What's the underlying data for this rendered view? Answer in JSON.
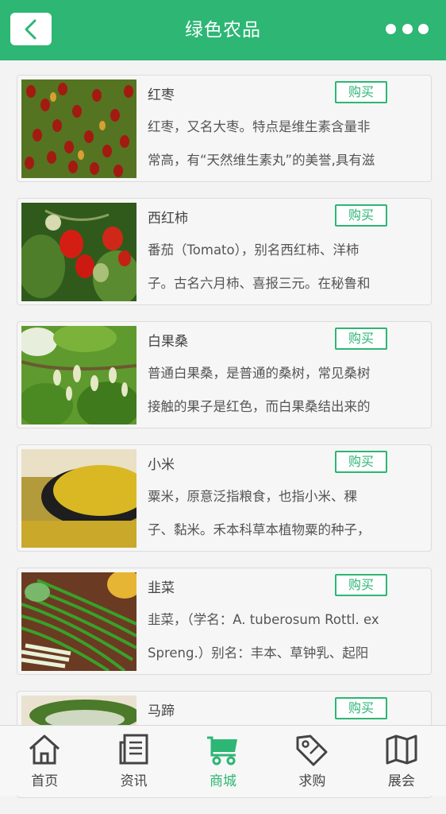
{
  "header": {
    "title": "绿色农品"
  },
  "products": [
    {
      "name": "红枣",
      "buy": "购买",
      "lines": [
        "红枣，又名大枣。特点是维生素含量非",
        "常高，有“天然维生素丸”的美誉,具有滋"
      ]
    },
    {
      "name": "西红柿",
      "buy": "购买",
      "lines": [
        "番茄（Tomato），别名西红柿、洋柿",
        "子。古名六月柿、喜报三元。在秘鲁和"
      ]
    },
    {
      "name": "白果桑",
      "buy": "购买",
      "lines": [
        "普通白果桑，是普通的桑树，常见桑树",
        "接触的果子是红色，而白果桑结出来的"
      ]
    },
    {
      "name": "小米",
      "buy": "购买",
      "lines": [
        "粟米，原意泛指粮食，也指小米、稞",
        "子、黏米。禾本科草本植物粟的种子，"
      ]
    },
    {
      "name": "韭菜",
      "buy": "购买",
      "lines": [
        "韭菜，（学名：A. tuberosum Rottl. ex",
        "Spreng.）别名：丰本、草钟乳、起阳"
      ]
    },
    {
      "name": "马蹄",
      "buy": "购买",
      "lines": [
        "",
        ""
      ]
    }
  ],
  "tabs": [
    {
      "label": "首页",
      "icon": "home-icon"
    },
    {
      "label": "资讯",
      "icon": "news-icon"
    },
    {
      "label": "商城",
      "icon": "cart-icon",
      "active": true
    },
    {
      "label": "求购",
      "icon": "tag-icon"
    },
    {
      "label": "展会",
      "icon": "map-icon"
    }
  ],
  "colors": {
    "accent": "#2db674"
  }
}
